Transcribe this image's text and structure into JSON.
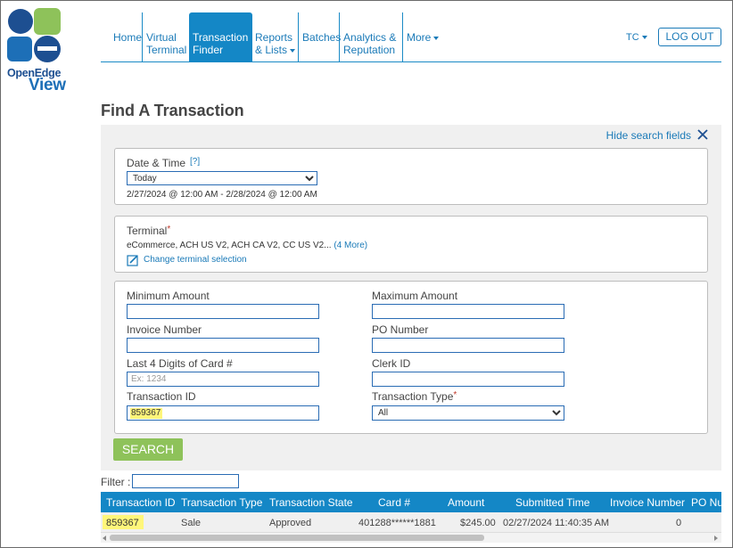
{
  "brand": {
    "line1": "OpenEdge",
    "line2": "View",
    "colors": {
      "dark_blue": "#1d4f91",
      "green": "#8ec25a",
      "light_blue": "#1487c6"
    }
  },
  "nav": {
    "home": "Home",
    "virtual_terminal": [
      "Virtual",
      "Terminal"
    ],
    "transaction_finder": [
      "Transaction",
      "Finder"
    ],
    "reports_lists": [
      "Reports",
      "& Lists"
    ],
    "batches": "Batches",
    "analytics": [
      "Analytics &",
      "Reputation"
    ],
    "more": "More",
    "user": "TC",
    "logout": "LOG OUT",
    "active": "transaction_finder"
  },
  "page": {
    "title": "Find A Transaction"
  },
  "search": {
    "hide_label": "Hide search fields",
    "date_time": {
      "label": "Date & Time",
      "help": "[?]",
      "selected": "Today",
      "range": "2/27/2024 @ 12:00 AM - 2/28/2024 @ 12:00 AM"
    },
    "terminal": {
      "label": "Terminal",
      "required_mark": "*",
      "selection": "eCommerce, ACH US V2, ACH CA V2, CC US V2...",
      "more": "(4 More)",
      "change": "Change terminal selection"
    },
    "fields": {
      "min_amount": {
        "label": "Minimum Amount",
        "value": ""
      },
      "max_amount": {
        "label": "Maximum Amount",
        "value": ""
      },
      "invoice": {
        "label": "Invoice Number",
        "value": ""
      },
      "po": {
        "label": "PO Number",
        "value": ""
      },
      "last4": {
        "label": "Last 4 Digits of Card #",
        "placeholder": "Ex: 1234"
      },
      "clerk": {
        "label": "Clerk ID",
        "value": ""
      },
      "transaction_id": {
        "label": "Transaction ID",
        "value": "859367"
      },
      "transaction_type": {
        "label": "Transaction Type",
        "required_mark": "*",
        "selected": "All"
      }
    },
    "search_button": "SEARCH"
  },
  "results": {
    "filter_label": "Filter :",
    "columns": [
      "Transaction ID",
      "Transaction Type",
      "Transaction State",
      "Card #",
      "Amount",
      "Submitted Time",
      "Invoice Number",
      "PO Nu"
    ],
    "rows": [
      [
        "859367",
        "Sale",
        "Approved",
        "401288******1881",
        "$245.00",
        "02/27/2024 11:40:35 AM",
        "0",
        ""
      ]
    ]
  }
}
